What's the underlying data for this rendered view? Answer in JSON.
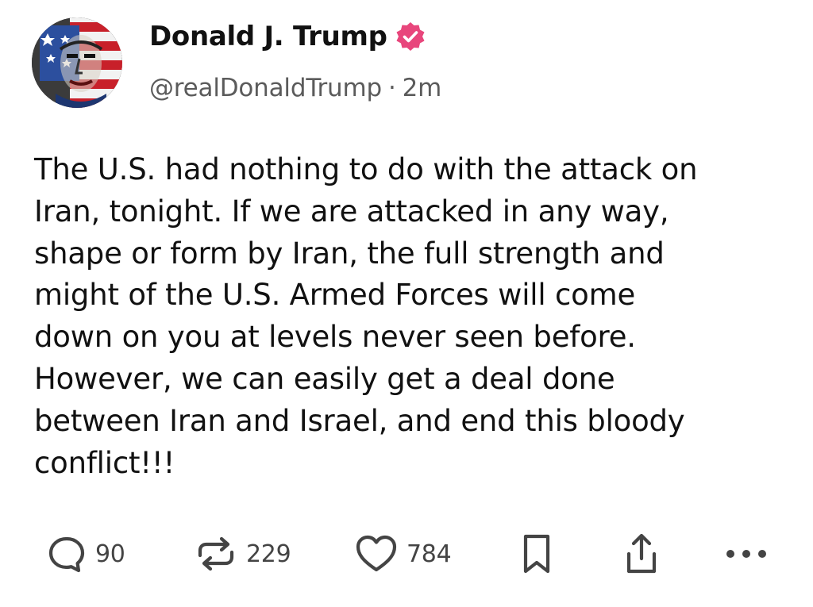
{
  "post": {
    "author": {
      "display_name": "Donald J. Trump",
      "verified_icon": "verified-badge-icon",
      "verified_color": "#e8467c",
      "handle": "@realDonaldTrump",
      "separator": "·",
      "time": "2m"
    },
    "text": "The U.S. had nothing to do with the attack on\nIran, tonight. If we are attacked in any way,\nshape or form by Iran, the full strength and\nmight of the U.S. Armed Forces will come\ndown on you at levels never seen before.\nHowever, we can easily get a deal done\nbetween Iran and Israel, and end this bloody\nconflict!!!",
    "actions": {
      "reply": {
        "icon": "reply-icon",
        "count": "90"
      },
      "repost": {
        "icon": "repost-icon",
        "count": "229"
      },
      "like": {
        "icon": "heart-icon",
        "count": "784"
      },
      "bookmark": {
        "icon": "bookmark-icon"
      },
      "share": {
        "icon": "share-icon"
      },
      "more": {
        "icon": "more-icon"
      }
    }
  }
}
